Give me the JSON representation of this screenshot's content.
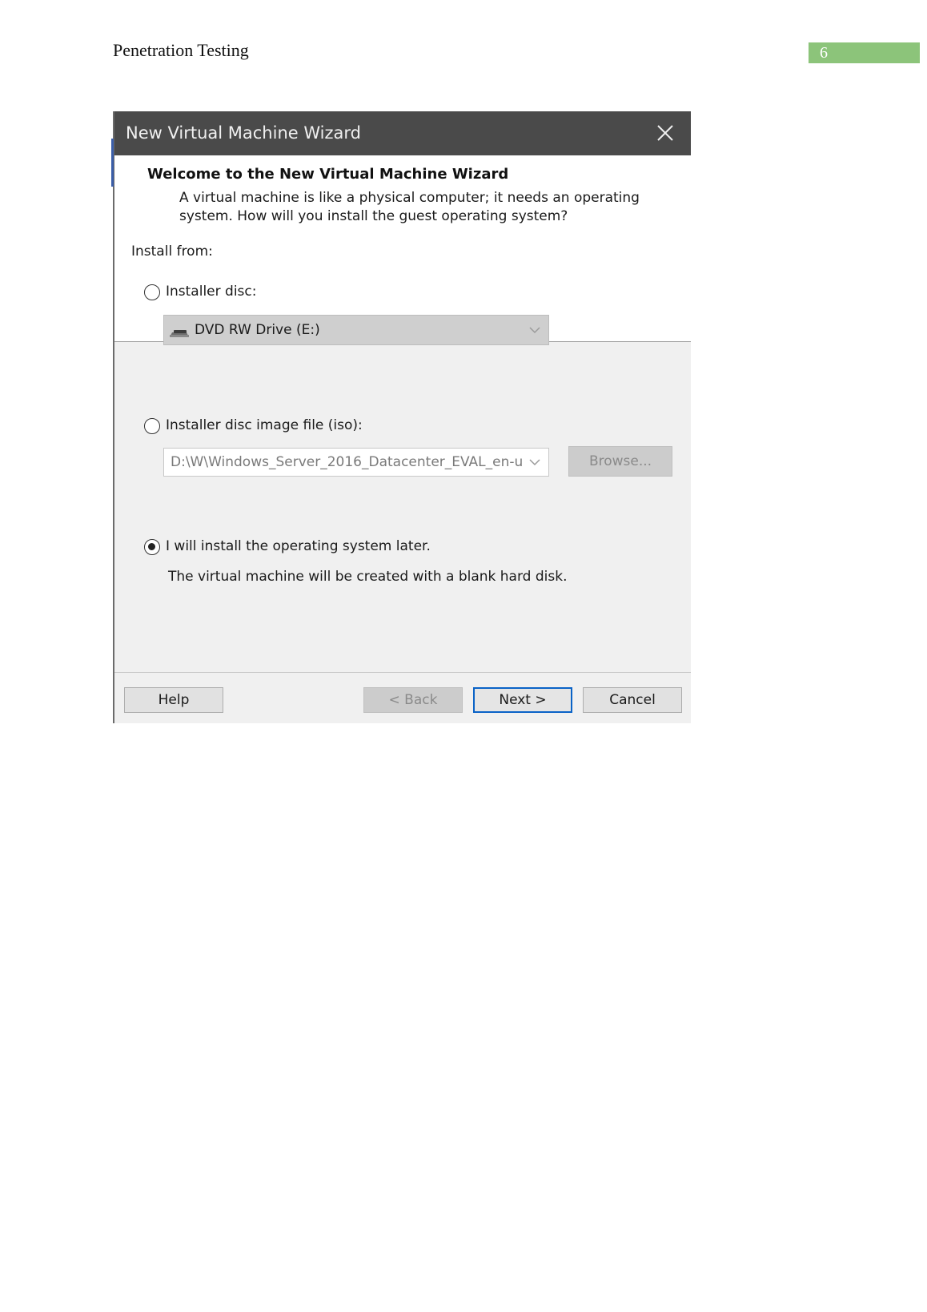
{
  "document": {
    "header_title": "Penetration Testing",
    "page_number": "6"
  },
  "dialog": {
    "title": "New Virtual Machine Wizard",
    "welcome_title": "Welcome to the New Virtual Machine Wizard",
    "welcome_desc_line1": "A virtual machine is like a physical computer; it needs an operating",
    "welcome_desc_line2": "system. How will you install the guest operating system?",
    "install_from_label": "Install from:",
    "options": {
      "installer_disc": {
        "label": "Installer disc:",
        "selected": false
      },
      "disc_drive_value": "DVD RW Drive (E:)",
      "iso_file": {
        "label": "Installer disc image file (iso):",
        "selected": false
      },
      "iso_path_value": "D:\\W\\Windows_Server_2016_Datacenter_EVAL_en-u",
      "browse_label": "Browse...",
      "install_later": {
        "label": "I will install the operating system later.",
        "selected": true
      },
      "install_later_desc": "The virtual machine will be created with a blank hard disk."
    },
    "buttons": {
      "help": "Help",
      "back": "< Back",
      "next": "Next >",
      "cancel": "Cancel"
    }
  }
}
